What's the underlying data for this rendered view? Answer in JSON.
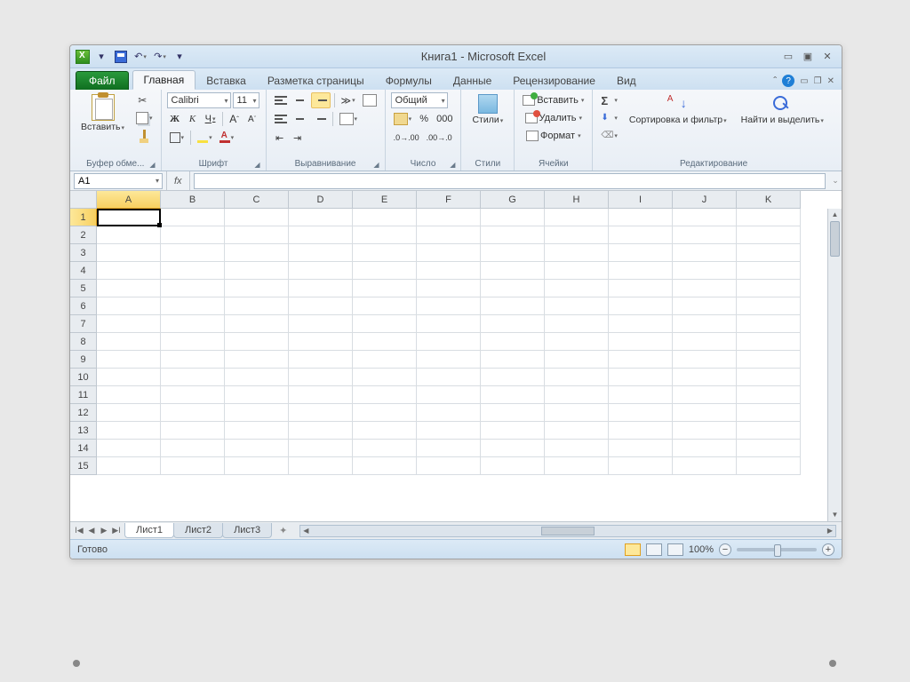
{
  "title": "Книга1  -  Microsoft Excel",
  "tabs": {
    "file": "Файл",
    "items": [
      "Главная",
      "Вставка",
      "Разметка страницы",
      "Формулы",
      "Данные",
      "Рецензирование",
      "Вид"
    ],
    "active": 0
  },
  "ribbon": {
    "clipboard": {
      "paste": "Вставить",
      "label": "Буфер обме..."
    },
    "font": {
      "name": "Calibri",
      "size": "11",
      "label": "Шрифт",
      "bold": "Ж",
      "italic": "К",
      "underline": "Ч"
    },
    "align": {
      "label": "Выравнивание"
    },
    "number": {
      "format": "Общий",
      "label": "Число",
      "percent": "%",
      "thousands": "000"
    },
    "styles": {
      "label": "Стили",
      "btn": "Стили"
    },
    "cells": {
      "insert": "Вставить",
      "delete": "Удалить",
      "format": "Формат",
      "label": "Ячейки"
    },
    "editing": {
      "sort": "Сортировка и фильтр",
      "find": "Найти и выделить",
      "label": "Редактирование"
    }
  },
  "formula": {
    "cell": "A1",
    "fx": "fx"
  },
  "columns": [
    "A",
    "B",
    "C",
    "D",
    "E",
    "F",
    "G",
    "H",
    "I",
    "J",
    "K"
  ],
  "rows": [
    "1",
    "2",
    "3",
    "4",
    "5",
    "6",
    "7",
    "8",
    "9",
    "10",
    "11",
    "12",
    "13",
    "14",
    "15"
  ],
  "sheets": {
    "tabs": [
      "Лист1",
      "Лист2",
      "Лист3"
    ],
    "active": 0
  },
  "status": {
    "ready": "Готово",
    "zoom": "100%"
  }
}
